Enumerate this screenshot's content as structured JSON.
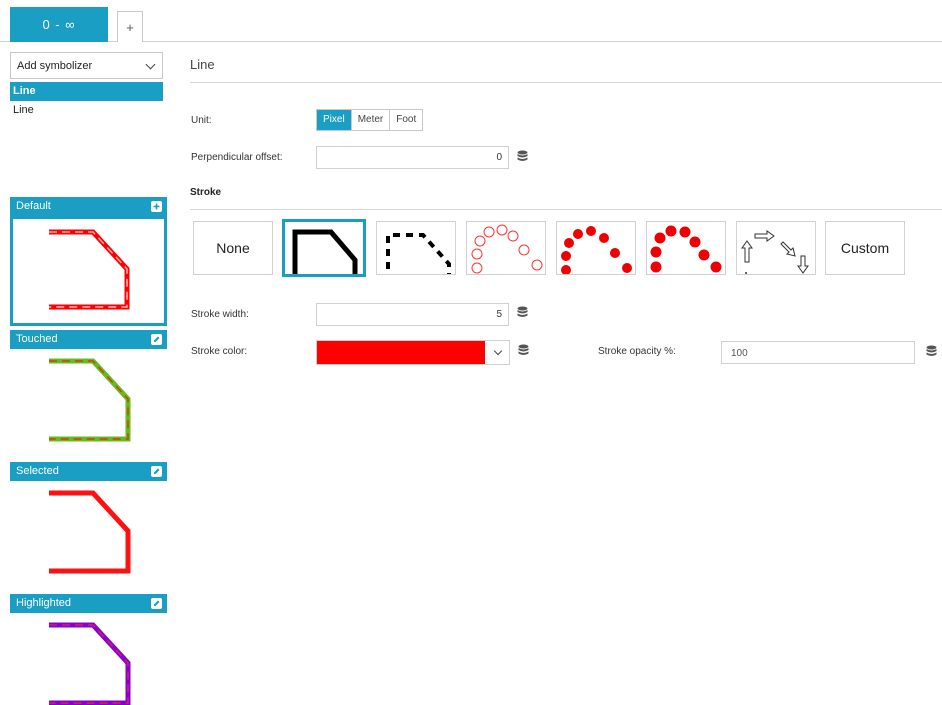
{
  "tabs": {
    "active_label": "0 - ∞",
    "add_label": "+"
  },
  "left": {
    "add_symbolizer": "Add symbolizer",
    "symbolizers": [
      "Line",
      "Line"
    ],
    "states": [
      {
        "label": "Default",
        "icon": "plus-square-icon",
        "line_color": "#ff0000",
        "dash_color": "#ffb0b0"
      },
      {
        "label": "Touched",
        "icon": "edit-icon",
        "line_color": "#66bb22",
        "dash_color": "#cc4400"
      },
      {
        "label": "Selected",
        "icon": "edit-icon",
        "line_color": "#ff1111",
        "dash_color": "#cc2222"
      },
      {
        "label": "Highlighted",
        "icon": "edit-icon",
        "line_color": "#8800cc",
        "dash_color": "#cc2266"
      }
    ]
  },
  "main": {
    "title": "Line",
    "unit_label": "Unit:",
    "units": [
      "Pixel",
      "Meter",
      "Foot"
    ],
    "unit_selected": "Pixel",
    "perp_offset_label": "Perpendicular offset:",
    "perp_offset_value": "0",
    "stroke_heading": "Stroke",
    "dash_options": [
      {
        "name": "none",
        "label": "None"
      },
      {
        "name": "solid"
      },
      {
        "name": "dashed"
      },
      {
        "name": "hollow-circles"
      },
      {
        "name": "red-dots"
      },
      {
        "name": "large-red-dots"
      },
      {
        "name": "arrows"
      },
      {
        "name": "custom",
        "label": "Custom"
      }
    ],
    "dash_selected": "solid",
    "stroke_width_label": "Stroke width:",
    "stroke_width_value": "5",
    "stroke_color_label": "Stroke color:",
    "stroke_color_value": "#ff0000",
    "stroke_opacity_label": "Stroke opacity %:",
    "stroke_opacity_value": "100"
  },
  "colors": {
    "accent": "#1a9ec3"
  }
}
